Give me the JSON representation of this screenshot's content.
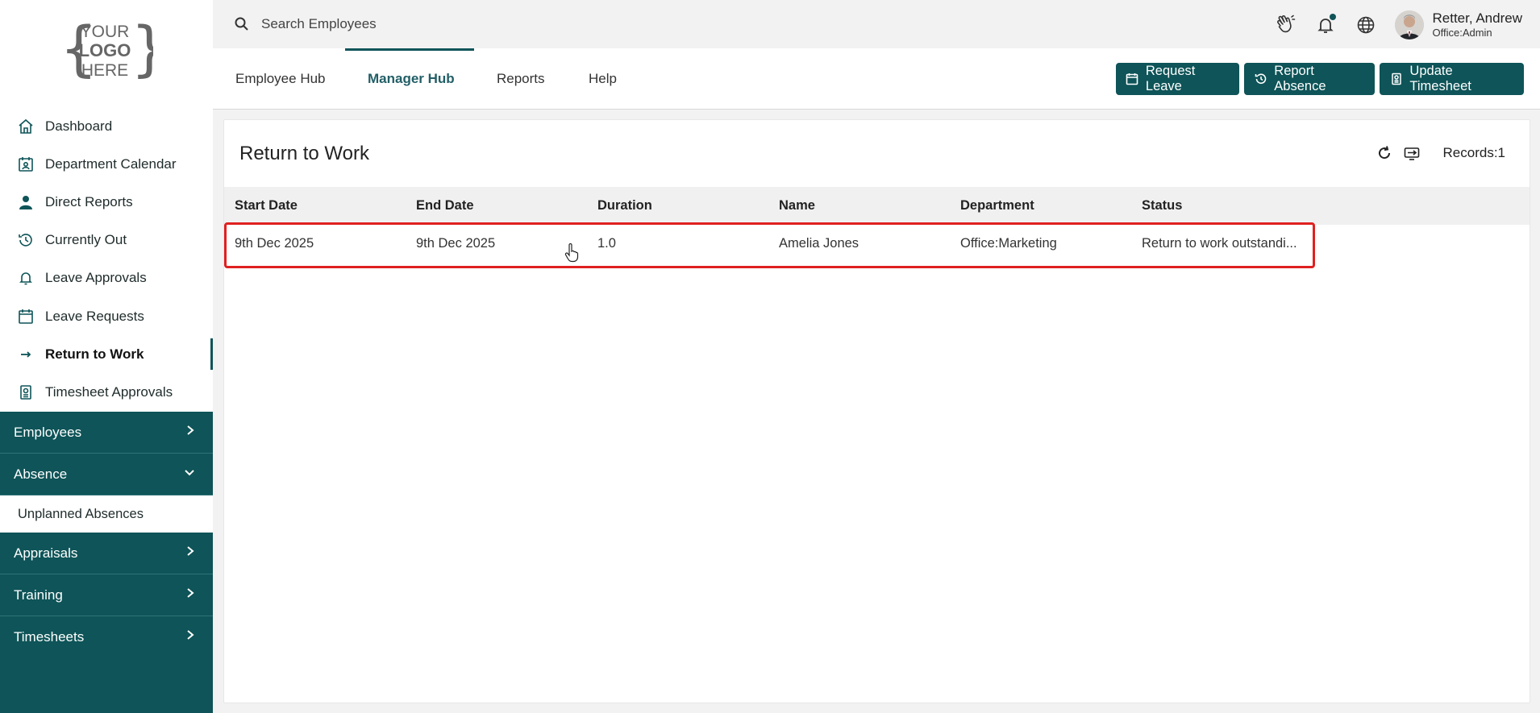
{
  "logo": {
    "line1": "YOUR",
    "line2": "LOGO",
    "line3": "HERE"
  },
  "search": {
    "placeholder": "Search Employees"
  },
  "user": {
    "name": "Retter, Andrew",
    "role": "Office:Admin"
  },
  "nav": [
    {
      "label": "Dashboard",
      "icon": "home-icon"
    },
    {
      "label": "Department Calendar",
      "icon": "calendar-user-icon"
    },
    {
      "label": "Direct Reports",
      "icon": "person-icon"
    },
    {
      "label": "Currently Out",
      "icon": "clock-history-icon"
    },
    {
      "label": "Leave Approvals",
      "icon": "bell-icon"
    },
    {
      "label": "Leave Requests",
      "icon": "calendar-icon"
    },
    {
      "label": "Return to Work",
      "icon": "arrow-right-icon",
      "active": true
    },
    {
      "label": "Timesheet Approvals",
      "icon": "timesheet-icon"
    }
  ],
  "sections": {
    "employees": "Employees",
    "absence": "Absence",
    "absence_sub": "Unplanned Absences",
    "appraisals": "Appraisals",
    "training": "Training",
    "timesheets": "Timesheets"
  },
  "tabs": {
    "employee_hub": "Employee Hub",
    "manager_hub": "Manager Hub",
    "reports": "Reports",
    "help": "Help"
  },
  "actions": {
    "request_leave": "Request Leave",
    "report_absence": "Report Absence",
    "update_timesheet": "Update Timesheet"
  },
  "page": {
    "title": "Return to Work",
    "records": "Records:1"
  },
  "table": {
    "columns": [
      "Start Date",
      "End Date",
      "Duration",
      "Name",
      "Department",
      "Status"
    ],
    "rows": [
      [
        "9th Dec 2025",
        "9th Dec 2025",
        "1.0",
        "Amelia Jones",
        "Office:Marketing",
        "Return to work outstandi..."
      ]
    ]
  },
  "colors": {
    "primary": "#0e5458",
    "highlight": "#e02020"
  }
}
